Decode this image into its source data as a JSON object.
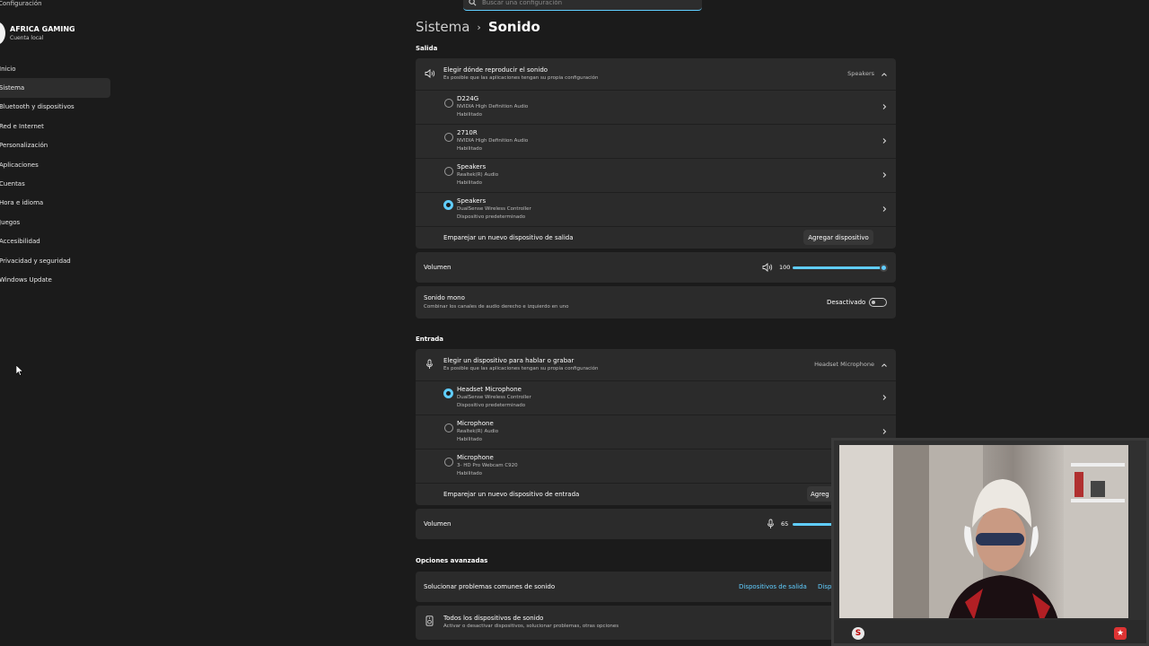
{
  "app": {
    "title": "Configuración"
  },
  "search": {
    "placeholder": "Buscar una configuración"
  },
  "account": {
    "name": "AFRICA GAMING",
    "type": "Cuenta local"
  },
  "nav": {
    "items": [
      {
        "label": "Inicio"
      },
      {
        "label": "Sistema"
      },
      {
        "label": "Bluetooth y dispositivos"
      },
      {
        "label": "Red e Internet"
      },
      {
        "label": "Personalización"
      },
      {
        "label": "Aplicaciones"
      },
      {
        "label": "Cuentas"
      },
      {
        "label": "Hora e idioma"
      },
      {
        "label": "Juegos"
      },
      {
        "label": "Accesibilidad"
      },
      {
        "label": "Privacidad y seguridad"
      },
      {
        "label": "Windows Update"
      }
    ],
    "active_index": 1
  },
  "header": {
    "parent": "Sistema",
    "separator": "›",
    "current": "Sonido"
  },
  "output": {
    "section_title": "Salida",
    "chooser_title": "Elegir dónde reproducir el sonido",
    "chooser_subtitle": "Es posible que las aplicaciones tengan su propia configuración",
    "selected": "Speakers",
    "devices": [
      {
        "name": "D224G",
        "driver": "NVIDIA High Definition Audio",
        "status": "Habilitado",
        "selected": false
      },
      {
        "name": "2710R",
        "driver": "NVIDIA High Definition Audio",
        "status": "Habilitado",
        "selected": false
      },
      {
        "name": "Speakers",
        "driver": "Realtek(R) Audio",
        "status": "Habilitado",
        "selected": false
      },
      {
        "name": "Speakers",
        "driver": "DualSense Wireless Controller",
        "status": "Dispositivo predeterminado",
        "selected": true
      }
    ],
    "pair_label": "Emparejar un nuevo dispositivo de salida",
    "pair_button": "Agregar dispositivo",
    "volume_label": "Volumen",
    "volume_value": "100",
    "mono_title": "Sonido mono",
    "mono_subtitle": "Combinar los canales de audio derecho e izquierdo en uno",
    "mono_state": "Desactivado"
  },
  "input": {
    "section_title": "Entrada",
    "chooser_title": "Elegir un dispositivo para hablar o grabar",
    "chooser_subtitle": "Es posible que las aplicaciones tengan su propia configuración",
    "selected": "Headset Microphone",
    "devices": [
      {
        "name": "Headset Microphone",
        "driver": "DualSense Wireless Controller",
        "status": "Dispositivo predeterminado",
        "selected": true
      },
      {
        "name": "Microphone",
        "driver": "Realtek(R) Audio",
        "status": "Habilitado",
        "selected": false
      },
      {
        "name": "Microphone",
        "driver": "3- HD Pro Webcam C920",
        "status": "Habilitado",
        "selected": false
      }
    ],
    "pair_label": "Emparejar un nuevo dispositivo de entrada",
    "pair_button": "Agreg",
    "volume_label": "Volumen",
    "volume_value": "65"
  },
  "advanced": {
    "section_title": "Opciones avanzadas",
    "troubleshoot_label": "Solucionar problemas comunes de sonido",
    "troubleshoot_output": "Dispositivos de salida",
    "troubleshoot_input": "Disp",
    "all_devices_title": "Todos los dispositivos de sonido",
    "all_devices_subtitle": "Activar o desactivar dispositivos, solucionar problemas, otras opciones"
  },
  "webcam": {
    "badge_letter": "S",
    "badge_star": "★"
  },
  "colors": {
    "accent": "#60cdff",
    "background": "#1b1b1b",
    "card": "#2b2b2b"
  }
}
